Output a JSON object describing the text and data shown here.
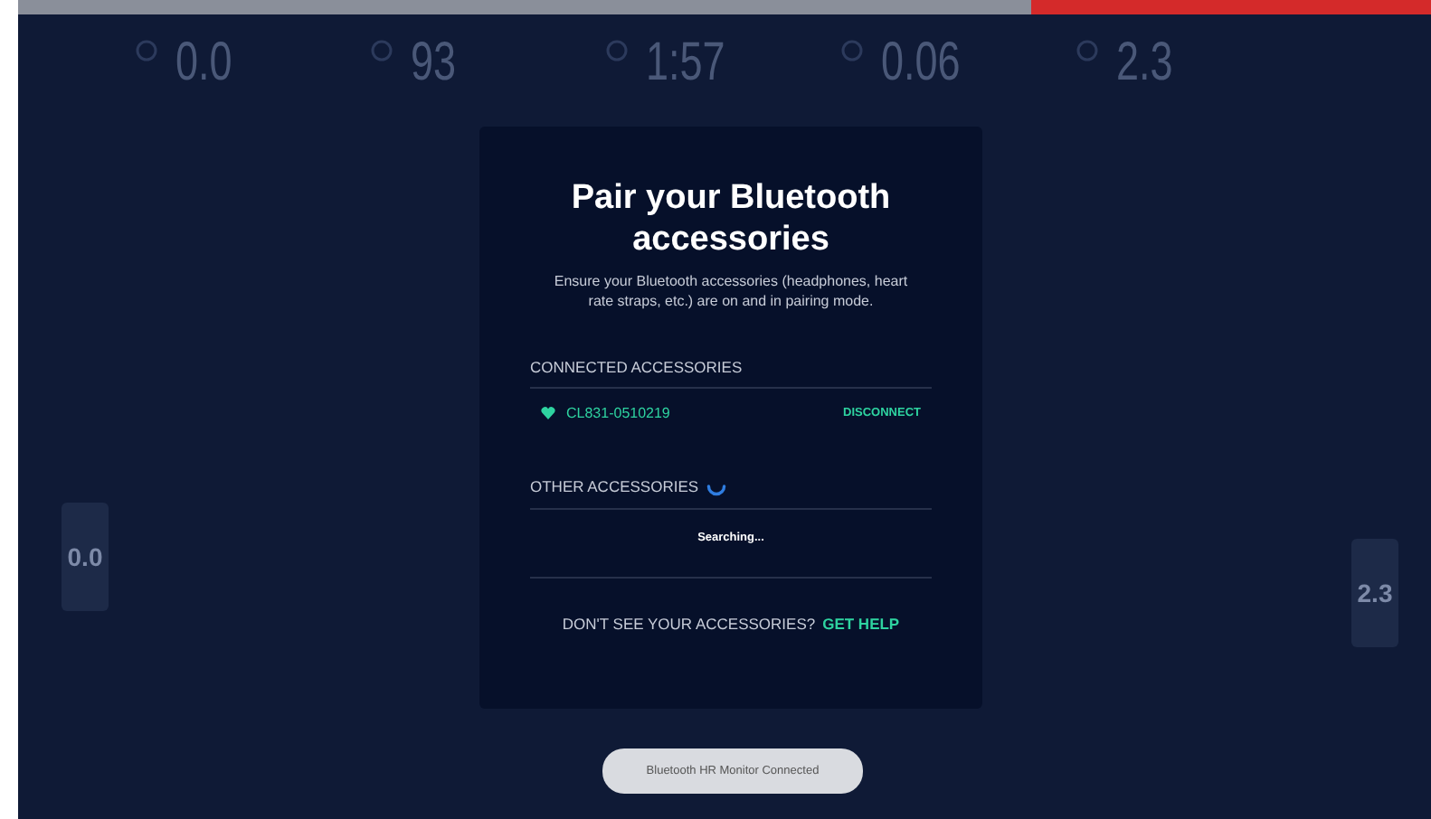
{
  "metrics": [
    {
      "value": "0.0"
    },
    {
      "value": "93"
    },
    {
      "value": "1:57"
    },
    {
      "value": "0.06"
    },
    {
      "value": "2.3"
    }
  ],
  "left_gauge": {
    "value": "0.0"
  },
  "right_gauge": {
    "value": "2.3"
  },
  "dialog": {
    "title": "Pair your Bluetooth accessories",
    "description": "Ensure your Bluetooth accessories (headphones, heart rate straps, etc.) are on and in pairing mode.",
    "connected_heading": "CONNECTED ACCESSORIES",
    "connected": [
      {
        "name": "CL831-0510219",
        "action": "DISCONNECT"
      }
    ],
    "other_heading": "OTHER ACCESSORIES",
    "searching": "Searching...",
    "help_text": "DON'T SEE YOUR ACCESSORIES?",
    "help_link": "GET HELP"
  },
  "toast": "Bluetooth HR Monitor Connected"
}
